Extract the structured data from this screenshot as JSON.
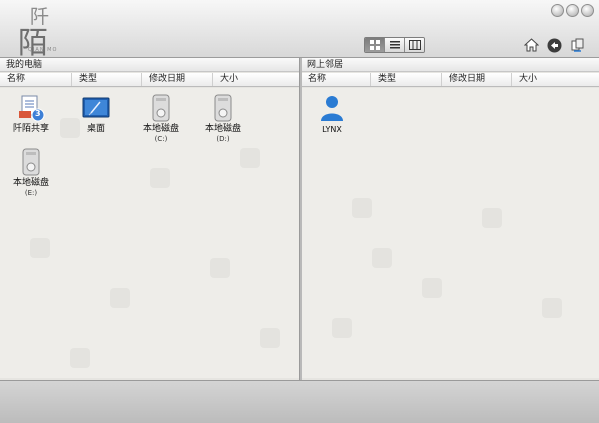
{
  "app": {
    "logo_char_top": "阡",
    "logo_char_main": "陌",
    "logo_subtitle": "QIAN MO"
  },
  "toolbar": {
    "view_modes": [
      "icon-view",
      "list-view",
      "column-view"
    ],
    "active_view": "icon-view",
    "home_icon": "home-icon",
    "back_icon": "back-arrow-icon",
    "refresh_icon": "refresh-icon"
  },
  "left_pane": {
    "title": "我的电脑",
    "columns": [
      "名称",
      "类型",
      "修改日期",
      "大小"
    ],
    "items": [
      {
        "label": "阡陌共享",
        "sub": "",
        "icon": "share-folder-icon",
        "badge": "3"
      },
      {
        "label": "桌面",
        "sub": "",
        "icon": "desktop-icon"
      },
      {
        "label": "本地磁盘",
        "sub": "(C:)",
        "icon": "disk-icon"
      },
      {
        "label": "本地磁盘",
        "sub": "(D:)",
        "icon": "disk-icon"
      },
      {
        "label": "本地磁盘",
        "sub": "(E:)",
        "icon": "disk-icon"
      }
    ]
  },
  "right_pane": {
    "title": "网上邻居",
    "columns": [
      "名称",
      "类型",
      "修改日期",
      "大小"
    ],
    "items": [
      {
        "label": "LYNX",
        "icon": "user-icon"
      }
    ]
  },
  "colors": {
    "accent_blue": "#2a7bd3",
    "badge_blue": "#3d7fd6",
    "background": "#eeede9"
  }
}
